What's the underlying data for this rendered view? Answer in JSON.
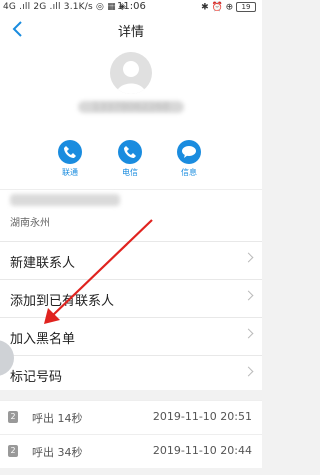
{
  "status": {
    "left": "4G .ıll 2G .ıll 3.1K/s ◎ ▦ ◈",
    "time": "11:06",
    "right": "✱ ⏰ ⊕",
    "battery": "19"
  },
  "nav": {
    "title": "详情"
  },
  "contact": {
    "number_blurred": "13378062268",
    "actions": [
      {
        "label": "联通",
        "icon": "phone-icon"
      },
      {
        "label": "电信",
        "icon": "phone-icon"
      },
      {
        "label": "信息",
        "icon": "message-icon"
      }
    ],
    "location": "湖南永州"
  },
  "menu": [
    {
      "label": "新建联系人"
    },
    {
      "label": "添加到已有联系人"
    },
    {
      "label": "加入黑名单"
    },
    {
      "label": "标记号码"
    }
  ],
  "calls": [
    {
      "sim": "2",
      "type": "呼出 14秒",
      "datetime": "2019-11-10 20:51"
    },
    {
      "sim": "2",
      "type": "呼出 34秒",
      "datetime": "2019-11-10 20:44"
    }
  ],
  "colors": {
    "accent": "#1a8cdf",
    "annotation_arrow": "#e0231f"
  }
}
